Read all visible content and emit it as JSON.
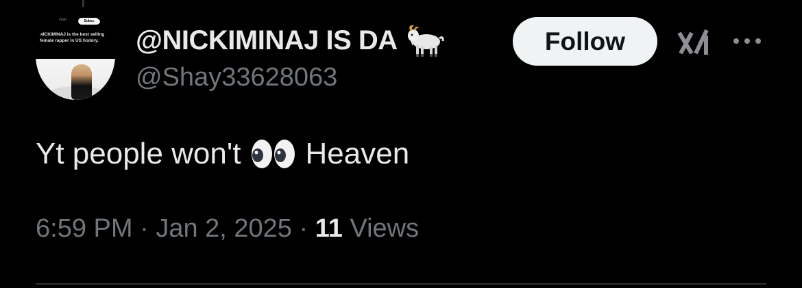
{
  "author": {
    "display_name": "@NICKIMINAJ IS DA",
    "display_emoji": "goat-emoji",
    "handle": "@Shay33628063",
    "avatar": {
      "overlay_text": "NICKIMINAJ is the best selling female rapper in US history.",
      "mini_name": "chart",
      "mini_button": "Subsc"
    }
  },
  "actions": {
    "follow_label": "Follow",
    "grok_icon": "grok-icon",
    "more_icon": "more-horizontal-icon"
  },
  "tweet": {
    "text_before": "Yt people won't",
    "emoji": "eyes-emoji",
    "text_after": "Heaven"
  },
  "meta": {
    "time": "6:59 PM",
    "separator": "·",
    "date": "Jan 2, 2025",
    "views_count": "11",
    "views_label": "Views"
  },
  "colors": {
    "background": "#000000",
    "primary_text": "#e7e9ea",
    "secondary_text": "#71767b",
    "follow_bg": "#eff3f4",
    "divider": "#2f3336"
  }
}
